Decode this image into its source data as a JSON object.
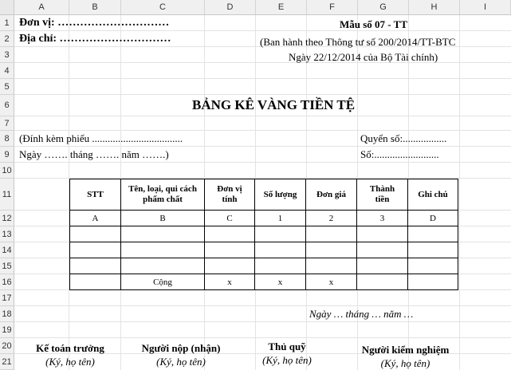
{
  "spreadsheet": {
    "columns": [
      "A",
      "B",
      "C",
      "D",
      "E",
      "F",
      "G",
      "H",
      "I"
    ],
    "rows": [
      "1",
      "2",
      "3",
      "4",
      "5",
      "6",
      "7",
      "8",
      "9",
      "10",
      "11",
      "12",
      "13",
      "14",
      "15",
      "16",
      "17",
      "18",
      "19",
      "20",
      "21"
    ]
  },
  "form": {
    "unit_label": "Đơn vị: …………………………",
    "address_label": "Địa chỉ: …………………………",
    "form_number": "Mẫu số 07 - TT",
    "issued_line1": "(Ban hành theo Thông  tư số 200/2014/TT-BTC",
    "issued_line2": "Ngày 22/12/2014 của Bộ Tài chính)",
    "title": "BẢNG KÊ VÀNG TIỀN TỆ",
    "attached": "(Đính kèm phiếu ...................................",
    "book_no": "Quyển số:.................",
    "date_line": "Ngày ……. tháng ……. năm …….)",
    "number": "Số:.........................",
    "sign_date": "Ngày … tháng … năm …"
  },
  "table": {
    "headers": [
      "STT",
      "Tên, loại, qui cách phẩm chất",
      "Đơn vị tính",
      "Số lượng",
      "Đơn giá",
      "Thành tiền",
      "Ghi chú"
    ],
    "codes": [
      "A",
      "B",
      "C",
      "1",
      "2",
      "3",
      "D"
    ],
    "total_row": [
      "",
      "Cộng",
      "x",
      "x",
      "x",
      "",
      ""
    ]
  },
  "signatures": [
    {
      "title": "Kế toán trưởng",
      "note": "(Ký, họ tên)"
    },
    {
      "title": "Người nộp (nhận)",
      "note": "(Ký, họ tên)"
    },
    {
      "title": "Thủ quỹ",
      "note": "(Ký, họ tên)"
    },
    {
      "title": "Người kiểm nghiệm",
      "note": "(Ký, họ tên)"
    }
  ]
}
